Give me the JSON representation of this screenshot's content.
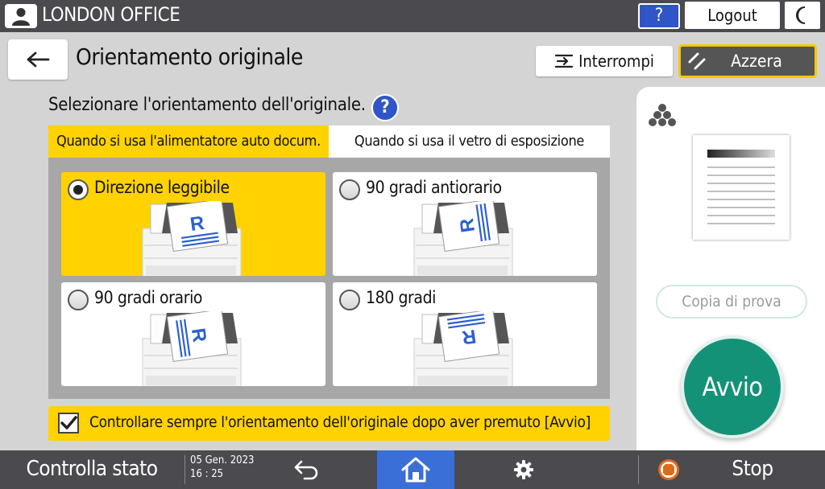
{
  "topbar": {
    "office_name": "LONDON OFFICE",
    "help_label": "?",
    "logout_label": "Logout"
  },
  "header": {
    "title": "Orientamento originale",
    "interrupt_label": "Interrompi",
    "reset_label": "Azzera"
  },
  "instruction": {
    "text": "Selezionare l'orientamento dell'originale.",
    "help_label": "?"
  },
  "tabs": [
    {
      "label": "Quando si usa l'alimentatore auto docum.",
      "active": true
    },
    {
      "label": "Quando si usa il vetro di esposizione",
      "active": false
    }
  ],
  "options": [
    {
      "label": "Direzione leggibile",
      "selected": true,
      "rotation_deg": 0
    },
    {
      "label": "90 gradi antiorario",
      "selected": false,
      "rotation_deg": -90
    },
    {
      "label": "90 gradi orario",
      "selected": false,
      "rotation_deg": 90
    },
    {
      "label": "180 gradi",
      "selected": false,
      "rotation_deg": 180
    }
  ],
  "always_check": {
    "label": "Controllare sempre l'orientamento dell'originale dopo aver premuto [Avvio]",
    "checked": true
  },
  "right_panel": {
    "sample_copy_label": "Copia di prova",
    "start_label": "Avvio"
  },
  "bottombar": {
    "status_check_label": "Controlla stato",
    "date": "05 Gen. 2023",
    "time": "16 : 25",
    "stop_label": "Stop"
  },
  "colors": {
    "accent_yellow": "#ffd200",
    "start_green": "#149278",
    "home_blue": "#3a6fd8",
    "help_blue": "#2f55c8",
    "bar_gray": "#4a4a4f"
  }
}
